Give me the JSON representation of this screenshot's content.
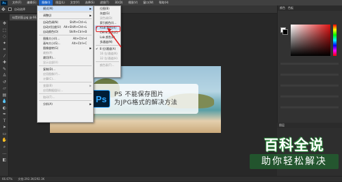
{
  "menubar": {
    "app_logo": "Ps",
    "items": [
      "文件(F)",
      "编辑(E)",
      "图像(I)",
      "图层(L)",
      "文字(Y)",
      "选择(S)",
      "滤镜(T)",
      "3D(D)",
      "视图(V)",
      "窗口(W)",
      "帮助(H)"
    ],
    "active_index": 2
  },
  "options_bar": {
    "auto_select_label": "自动选择"
  },
  "doc_tab": {
    "title": "似是封面.jpg @ 66.7%(RGB/8#)"
  },
  "image_menu": {
    "items": [
      {
        "label": "模式(M)",
        "shortcut": "",
        "submenu": true,
        "highlighted": true
      },
      {
        "sep": true
      },
      {
        "label": "调整(J)",
        "shortcut": "",
        "submenu": true
      },
      {
        "sep": true
      },
      {
        "label": "自动色调(N)",
        "shortcut": "Shift+Ctrl+L"
      },
      {
        "label": "自动对比度(U)",
        "shortcut": "Alt+Shift+Ctrl+L"
      },
      {
        "label": "自动颜色(O)",
        "shortcut": "Shift+Ctrl+B"
      },
      {
        "sep": true
      },
      {
        "label": "图像大小(I)...",
        "shortcut": "Alt+Ctrl+I"
      },
      {
        "label": "画布大小(S)...",
        "shortcut": "Alt+Ctrl+C"
      },
      {
        "label": "图像旋转(G)",
        "shortcut": "",
        "submenu": true
      },
      {
        "label": "裁剪(P)",
        "shortcut": "",
        "disabled": true
      },
      {
        "label": "裁切(R)...",
        "shortcut": ""
      },
      {
        "label": "显示全部(V)",
        "shortcut": "",
        "disabled": true
      },
      {
        "sep": true
      },
      {
        "label": "复制(D)...",
        "shortcut": ""
      },
      {
        "label": "应用图像(Y)...",
        "shortcut": "",
        "disabled": true
      },
      {
        "label": "计算(C)...",
        "shortcut": "",
        "disabled": true
      },
      {
        "sep": true
      },
      {
        "label": "变量(B)",
        "shortcut": "",
        "submenu": true,
        "disabled": true
      },
      {
        "label": "应用数据组(L)...",
        "shortcut": "",
        "disabled": true
      },
      {
        "sep": true
      },
      {
        "label": "陷印(T)...",
        "shortcut": "",
        "disabled": true
      },
      {
        "sep": true
      },
      {
        "label": "分析(A)",
        "shortcut": "",
        "submenu": true
      }
    ]
  },
  "mode_menu": {
    "items": [
      {
        "label": "位图(B)",
        "disabled": false
      },
      {
        "label": "灰度(G)"
      },
      {
        "label": "双色调(D)",
        "disabled": true
      },
      {
        "label": "索引颜色(I)..."
      },
      {
        "label": "RGB 颜色(R)",
        "checked": true,
        "highlighted": true
      },
      {
        "label": "CMYK 颜色(C)"
      },
      {
        "label": "Lab 颜色(L)"
      },
      {
        "label": "多通道(M)"
      },
      {
        "sep": true
      },
      {
        "label": "8 位/通道(A)",
        "checked": true
      },
      {
        "label": "16 位/通道(N)",
        "disabled": true
      },
      {
        "label": "32 位/通道(H)",
        "disabled": true
      },
      {
        "sep": true
      },
      {
        "label": "颜色表(T)...",
        "disabled": true
      }
    ]
  },
  "overlay": {
    "badge": "Ps",
    "line1": "PS 不能保存图片",
    "line2": "为JPG格式的解决方法"
  },
  "right_panel": {
    "tabs": [
      "颜色",
      "色板"
    ],
    "layers_label": "图层"
  },
  "status_bar": {
    "zoom": "66.67%",
    "doc_info": "文档:292.3K/292.3K"
  },
  "watermark": {
    "line1": "百科全说",
    "line2": "助你轻松解决"
  },
  "colors": {
    "accent": "#1b64c9",
    "highlight_box": "#e02020",
    "watermark_green": "#2a8a3a"
  }
}
